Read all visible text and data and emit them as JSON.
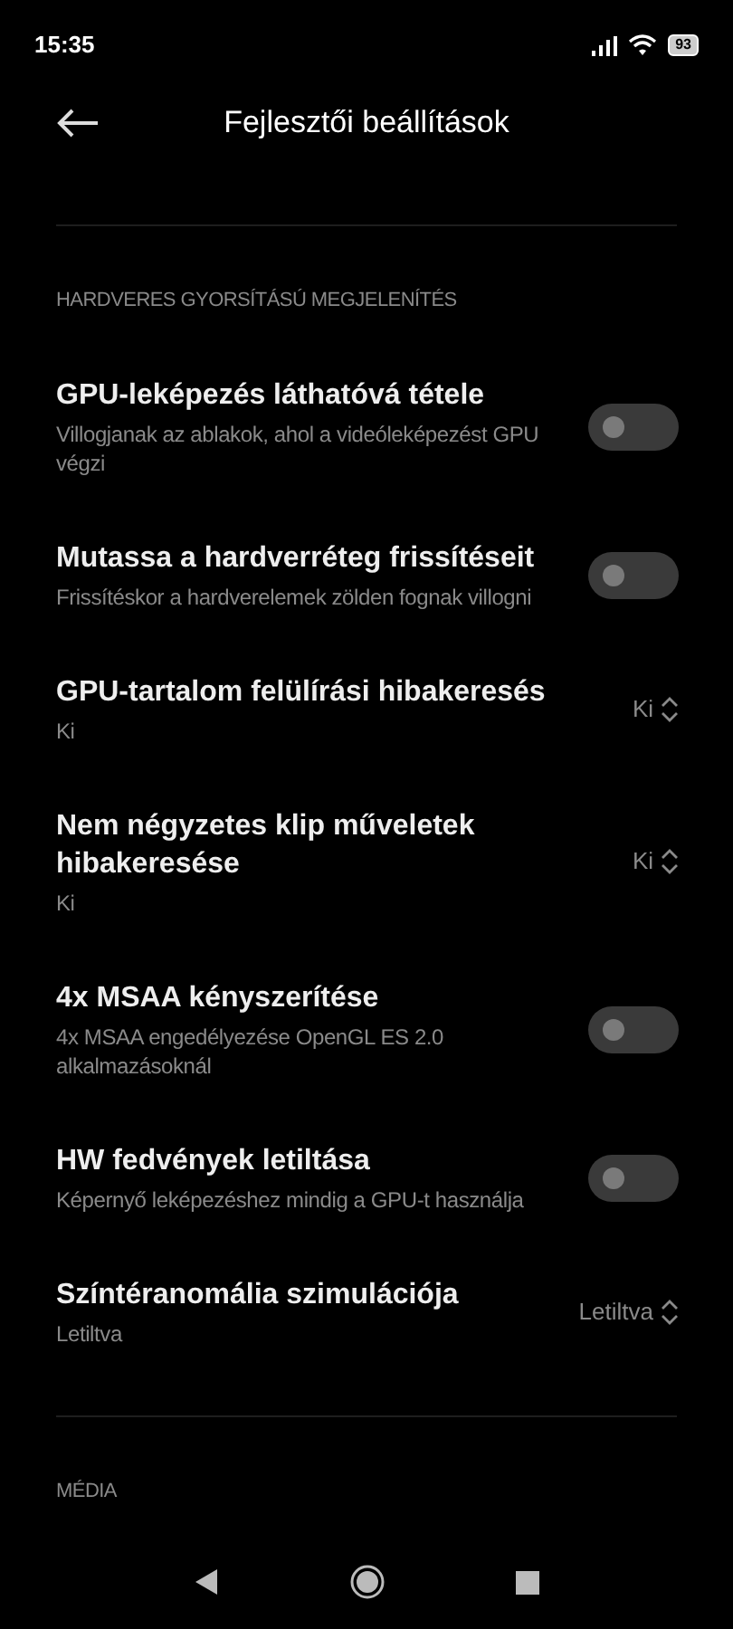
{
  "status_bar": {
    "time": "15:35",
    "battery": "93"
  },
  "header": {
    "title": "Fejlesztői beállítások"
  },
  "sections": [
    {
      "title": "HARDVERES GYORSÍTÁSÚ MEGJELENÍTÉS",
      "items": [
        {
          "kind": "toggle",
          "title": "GPU-leképezés láthatóvá tétele",
          "subtitle": "Villogjanak az ablakok, ahol a videóleképezést GPU végzi",
          "on": false
        },
        {
          "kind": "toggle",
          "title": "Mutassa a hardverréteg frissítéseit",
          "subtitle": "Frissítéskor a hardverelemek zölden fognak villogni",
          "on": false
        },
        {
          "kind": "picker",
          "title": "GPU-tartalom felülírási hibakeresés",
          "subtitle": "Ki",
          "value": "Ki"
        },
        {
          "kind": "picker",
          "title": "Nem négyzetes klip műveletek hibakeresése",
          "subtitle": "Ki",
          "value": "Ki"
        },
        {
          "kind": "toggle",
          "title": "4x MSAA kényszerítése",
          "subtitle": "4x MSAA engedélyezése OpenGL ES 2.0 alkalmazásoknál",
          "on": false
        },
        {
          "kind": "toggle",
          "title": "HW fedvények letiltása",
          "subtitle": "Képernyő leképezéshez mindig a GPU-t használja",
          "on": false
        },
        {
          "kind": "picker",
          "title": "Színtéranomália szimulációja",
          "subtitle": "Letiltva",
          "value": "Letiltva"
        }
      ]
    },
    {
      "title": "MÉDIA"
    }
  ]
}
